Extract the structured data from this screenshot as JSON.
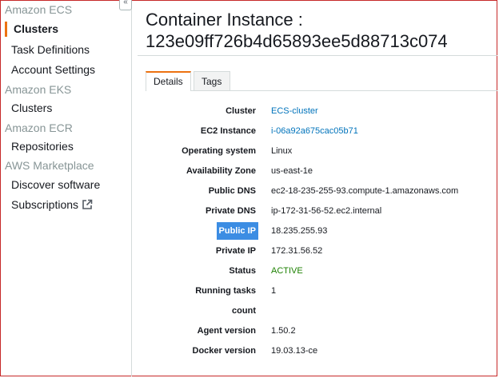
{
  "sidebar": {
    "sections": [
      {
        "title": "Amazon ECS",
        "items": [
          "Clusters",
          "Task Definitions",
          "Account Settings"
        ]
      },
      {
        "title": "Amazon EKS",
        "items": [
          "Clusters"
        ]
      },
      {
        "title": "Amazon ECR",
        "items": [
          "Repositories"
        ]
      },
      {
        "title": "AWS Marketplace",
        "items": [
          "Discover software",
          "Subscriptions"
        ]
      }
    ],
    "active_item": "Clusters",
    "collapse_glyph": "«",
    "external_link_icon": "external-link-icon"
  },
  "header": {
    "title_line1": "Container Instance :",
    "title_line2": "123e09ff726b4d65893ee5d88713c074"
  },
  "tabs": [
    {
      "label": "Details",
      "selected": true
    },
    {
      "label": "Tags",
      "selected": false
    }
  ],
  "details": [
    {
      "label": "Cluster",
      "value": "ECS-cluster"
    },
    {
      "label": "EC2 Instance",
      "value": "i-06a92a675cac05b71"
    },
    {
      "label": "Operating system",
      "value": "Linux"
    },
    {
      "label": "Availability Zone",
      "value": "us-east-1e"
    },
    {
      "label": "Public DNS",
      "value": "ec2-18-235-255-93.compute-1.amazonaws.com"
    },
    {
      "label": "Private DNS",
      "value": "ip-172-31-56-52.ec2.internal"
    },
    {
      "label": "Public IP",
      "value": "18.235.255.93"
    },
    {
      "label": "Private IP",
      "value": "172.31.56.52"
    },
    {
      "label": "Status",
      "value": "ACTIVE"
    },
    {
      "label": "Running tasks",
      "value": "1"
    },
    {
      "label": "count",
      "value": ""
    },
    {
      "label": "Agent version",
      "value": "1.50.2"
    },
    {
      "label": "Docker version",
      "value": "19.03.13-ce"
    }
  ],
  "colors": {
    "accent": "#ec7211",
    "link": "#0073bb",
    "status_active": "#1d8102",
    "selection": "#3c8de3",
    "frame_border": "#c62828"
  }
}
